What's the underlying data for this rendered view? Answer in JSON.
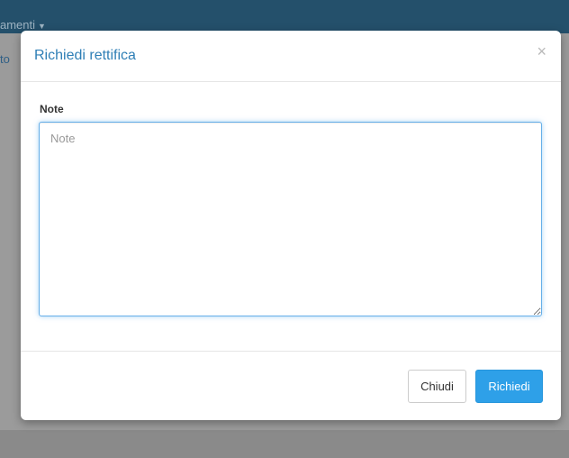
{
  "background": {
    "nav_text": "amenti",
    "side_text": "to"
  },
  "modal": {
    "title": "Richiedi rettifica",
    "close_symbol": "×",
    "note_label": "Note",
    "note_placeholder": "Note",
    "note_value": "",
    "buttons": {
      "close_label": "Chiudi",
      "submit_label": "Richiedi"
    }
  },
  "colors": {
    "title": "#2f7fb6",
    "primary_button": "#2ea0e8",
    "navbar": "#24506b",
    "overlay": "#8a8a8a"
  },
  "icons": {
    "close": "close-icon",
    "caret": "chevron-down-icon",
    "resize": "resize-handle-icon"
  }
}
